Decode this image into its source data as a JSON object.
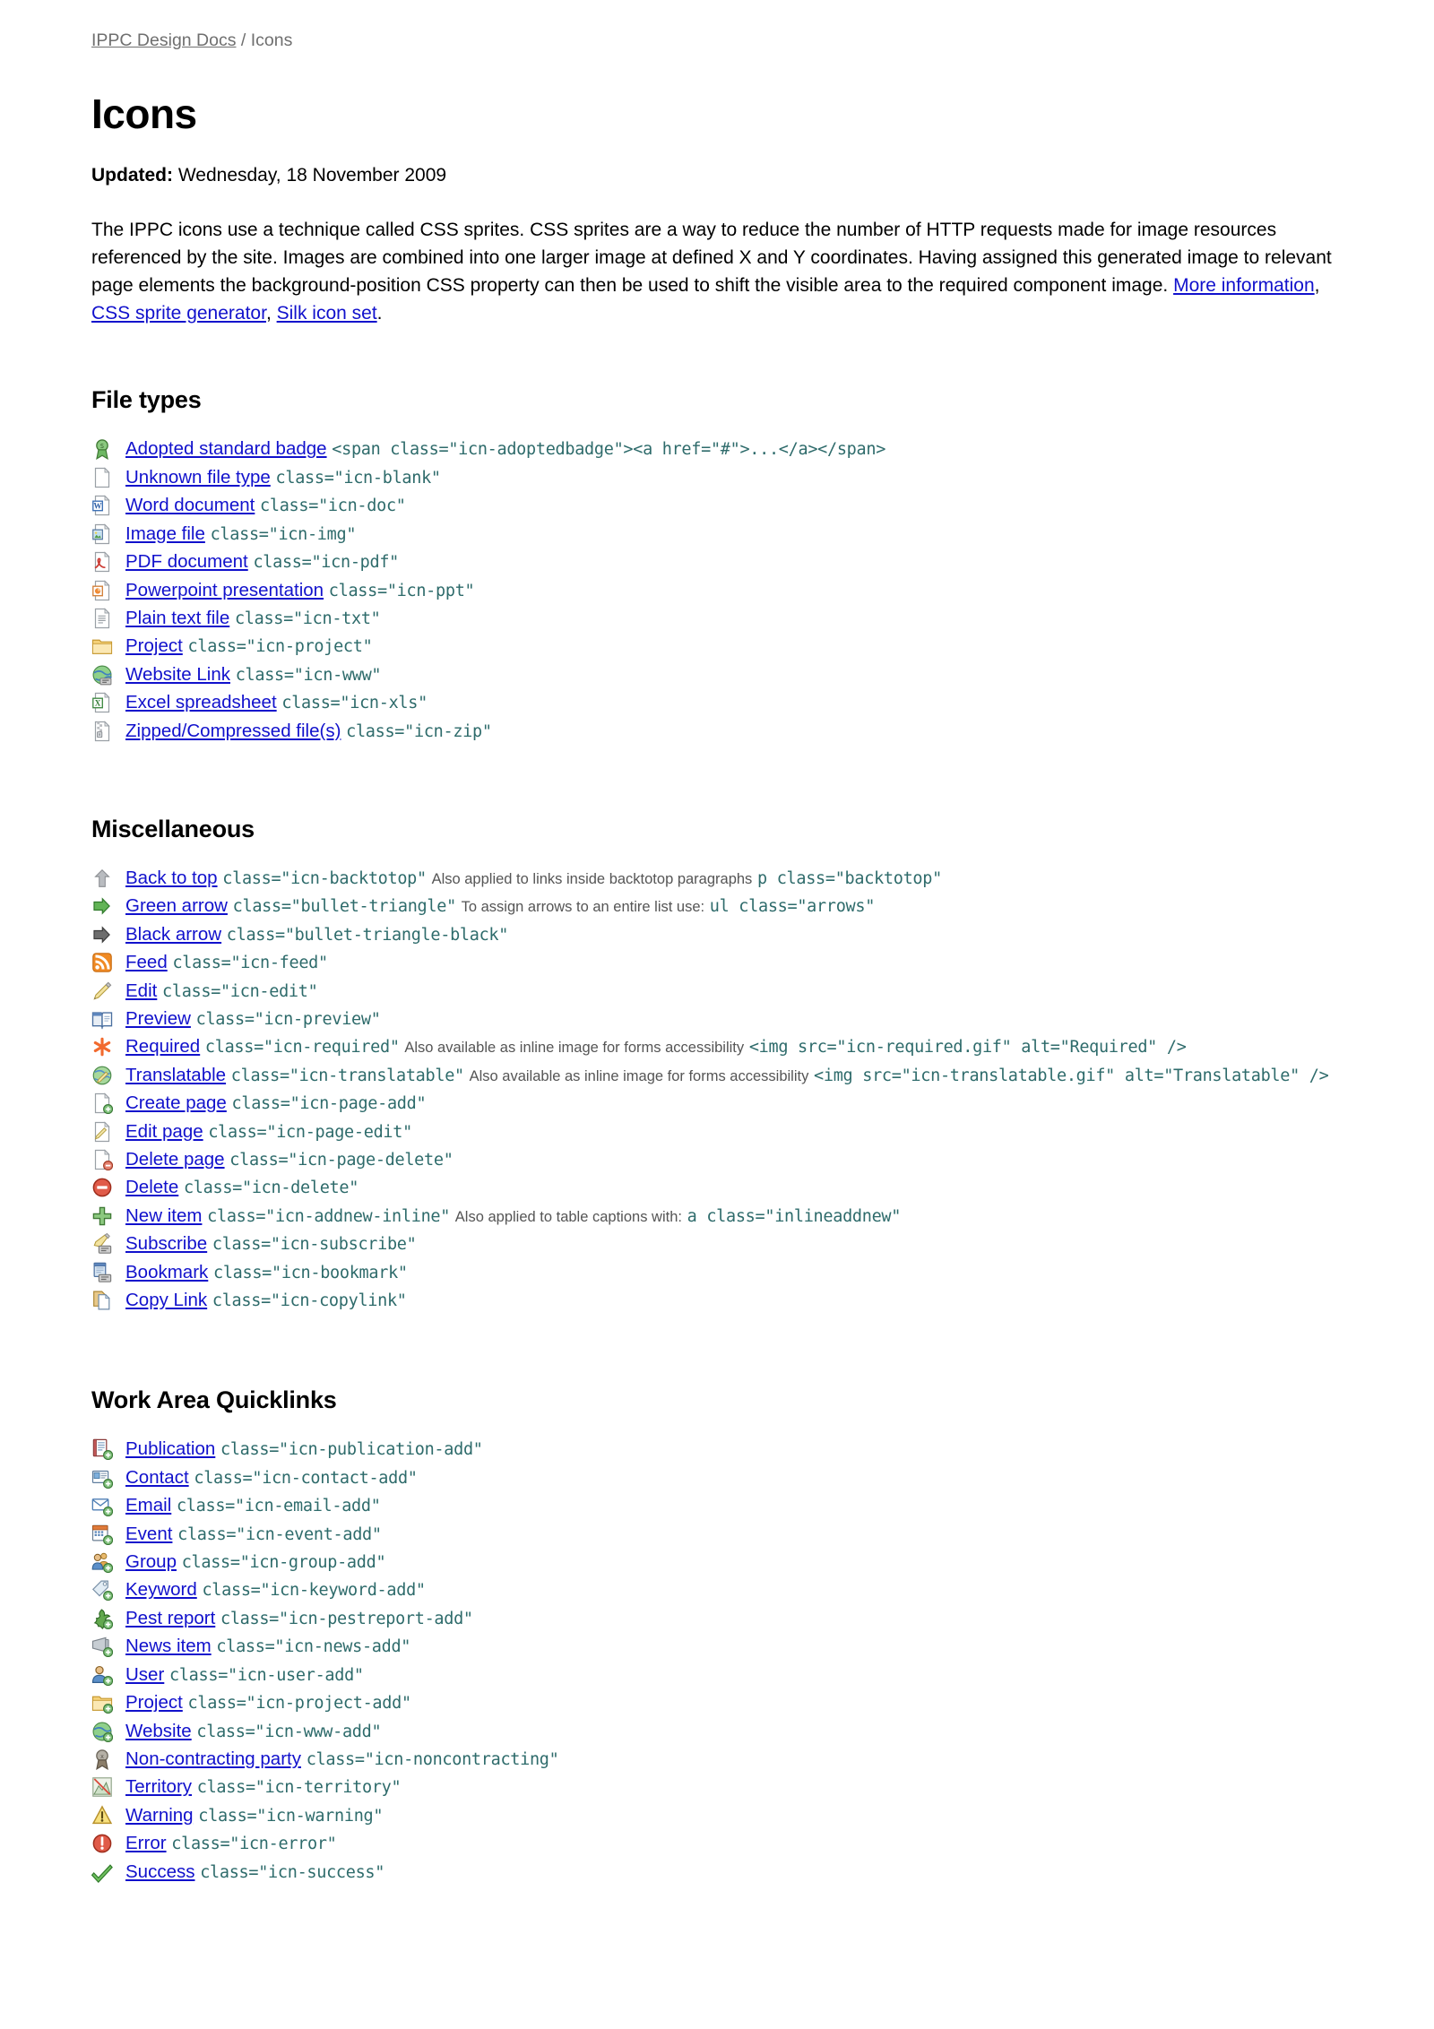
{
  "breadcrumb": {
    "parent": "IPPC Design Docs",
    "separator": "/",
    "current": "Icons"
  },
  "page_title": "Icons",
  "updated": {
    "label": "Updated:",
    "value": "Wednesday, 18 November 2009"
  },
  "intro": {
    "text_1": "The IPPC icons use a technique called CSS sprites. CSS sprites are a way to reduce the number of HTTP requests made for image resources referenced by the site. Images are combined into one larger image at defined X and Y coordinates. Having assigned this generated image to relevant page elements the background-position CSS property can then be used to shift the visible area to the required component image. ",
    "link_1": "More information",
    "sep_1": ", ",
    "link_2": "CSS sprite generator",
    "sep_2": ", ",
    "link_3": "Silk icon set",
    "text_end": "."
  },
  "sections": [
    {
      "id": "file-types",
      "title": "File types",
      "items": [
        {
          "icon": "adopted-badge-icon",
          "label": "Adopted standard badge",
          "code": "<span class=\"icn-adoptedbadge\"><a href=\"#\">...</a></span>",
          "note": "",
          "code2": ""
        },
        {
          "icon": "blank-file-icon",
          "label": "Unknown file type",
          "code": "class=\"icn-blank\"",
          "note": "",
          "code2": ""
        },
        {
          "icon": "word-document-icon",
          "label": "Word document",
          "code": "class=\"icn-doc\"",
          "note": "",
          "code2": ""
        },
        {
          "icon": "image-file-icon",
          "label": "Image file",
          "code": "class=\"icn-img\"",
          "note": "",
          "code2": ""
        },
        {
          "icon": "pdf-document-icon",
          "label": "PDF document",
          "code": "class=\"icn-pdf\"",
          "note": "",
          "code2": ""
        },
        {
          "icon": "powerpoint-icon",
          "label": "Powerpoint presentation",
          "code": "class=\"icn-ppt\"",
          "note": "",
          "code2": ""
        },
        {
          "icon": "plain-text-icon",
          "label": "Plain text file",
          "code": "class=\"icn-txt\"",
          "note": "",
          "code2": ""
        },
        {
          "icon": "project-folder-icon",
          "label": "Project",
          "code": "class=\"icn-project\"",
          "note": "",
          "code2": ""
        },
        {
          "icon": "website-link-icon",
          "label": "Website Link",
          "code": "class=\"icn-www\"",
          "note": "",
          "code2": ""
        },
        {
          "icon": "excel-spreadsheet-icon",
          "label": "Excel spreadsheet",
          "code": "class=\"icn-xls\"",
          "note": "",
          "code2": ""
        },
        {
          "icon": "zip-file-icon",
          "label": "Zipped/Compressed file(s)",
          "code": "class=\"icn-zip\"",
          "note": "",
          "code2": ""
        }
      ]
    },
    {
      "id": "miscellaneous",
      "title": "Miscellaneous",
      "items": [
        {
          "icon": "backtotop-arrow-icon",
          "label": "Back to top",
          "code": "class=\"icn-backtotop\"",
          "note": "Also applied to links inside backtotop paragraphs",
          "code2": "p class=\"backtotop\""
        },
        {
          "icon": "green-arrow-icon",
          "label": "Green arrow",
          "code": "class=\"bullet-triangle\"",
          "note": "To assign arrows to an entire list use:",
          "code2": "ul class=\"arrows\""
        },
        {
          "icon": "black-arrow-icon",
          "label": "Black arrow",
          "code": "class=\"bullet-triangle-black\"",
          "note": "",
          "code2": ""
        },
        {
          "icon": "feed-icon",
          "label": "Feed",
          "code": "class=\"icn-feed\"",
          "note": "",
          "code2": ""
        },
        {
          "icon": "edit-pencil-icon",
          "label": "Edit",
          "code": "class=\"icn-edit\"",
          "note": "",
          "code2": ""
        },
        {
          "icon": "preview-book-icon",
          "label": "Preview",
          "code": "class=\"icn-preview\"",
          "note": "",
          "code2": ""
        },
        {
          "icon": "required-asterisk-icon",
          "label": "Required",
          "code": "class=\"icn-required\"",
          "note": "Also available as inline image for forms accessibility",
          "code2": "<img src=\"icn-required.gif\" alt=\"Required\" />"
        },
        {
          "icon": "translatable-icon",
          "label": "Translatable",
          "code": "class=\"icn-translatable\"",
          "note": "Also available as inline image for forms accessibility",
          "code2": "<img src=\"icn-translatable.gif\" alt=\"Translatable\" />"
        },
        {
          "icon": "page-add-icon",
          "label": "Create page",
          "code": "class=\"icn-page-add\"",
          "note": "",
          "code2": ""
        },
        {
          "icon": "page-edit-icon",
          "label": "Edit page",
          "code": "class=\"icn-page-edit\"",
          "note": "",
          "code2": ""
        },
        {
          "icon": "page-delete-icon",
          "label": "Delete page",
          "code": "class=\"icn-page-delete\"",
          "note": "",
          "code2": ""
        },
        {
          "icon": "delete-icon",
          "label": "Delete",
          "code": "class=\"icn-delete\"",
          "note": "",
          "code2": ""
        },
        {
          "icon": "addnew-inline-icon",
          "label": "New item",
          "code": "class=\"icn-addnew-inline\"",
          "note": "Also applied to table captions with:",
          "code2": "a class=\"inlineaddnew\""
        },
        {
          "icon": "subscribe-icon",
          "label": "Subscribe",
          "code": "class=\"icn-subscribe\"",
          "note": "",
          "code2": ""
        },
        {
          "icon": "bookmark-icon",
          "label": "Bookmark",
          "code": "class=\"icn-bookmark\"",
          "note": "",
          "code2": ""
        },
        {
          "icon": "copylink-icon",
          "label": "Copy Link",
          "code": "class=\"icn-copylink\"",
          "note": "",
          "code2": ""
        }
      ]
    },
    {
      "id": "work-area-quicklinks",
      "title": "Work Area Quicklinks",
      "items": [
        {
          "icon": "publication-add-icon",
          "label": "Publication",
          "code": "class=\"icn-publication-add\"",
          "note": "",
          "code2": ""
        },
        {
          "icon": "contact-add-icon",
          "label": "Contact",
          "code": "class=\"icn-contact-add\"",
          "note": "",
          "code2": ""
        },
        {
          "icon": "email-add-icon",
          "label": "Email",
          "code": "class=\"icn-email-add\"",
          "note": "",
          "code2": ""
        },
        {
          "icon": "event-add-icon",
          "label": "Event",
          "code": "class=\"icn-event-add\"",
          "note": "",
          "code2": ""
        },
        {
          "icon": "group-add-icon",
          "label": "Group",
          "code": "class=\"icn-group-add\"",
          "note": "",
          "code2": ""
        },
        {
          "icon": "keyword-add-icon",
          "label": "Keyword",
          "code": "class=\"icn-keyword-add\"",
          "note": "",
          "code2": ""
        },
        {
          "icon": "pestreport-add-icon",
          "label": "Pest report",
          "code": "class=\"icn-pestreport-add\"",
          "note": "",
          "code2": ""
        },
        {
          "icon": "news-add-icon",
          "label": "News item",
          "code": "class=\"icn-news-add\"",
          "note": "",
          "code2": ""
        },
        {
          "icon": "user-add-icon",
          "label": "User",
          "code": "class=\"icn-user-add\"",
          "note": "",
          "code2": ""
        },
        {
          "icon": "project-add-icon",
          "label": "Project",
          "code": "class=\"icn-project-add\"",
          "note": "",
          "code2": ""
        },
        {
          "icon": "www-add-icon",
          "label": "Website",
          "code": "class=\"icn-www-add\"",
          "note": "",
          "code2": ""
        },
        {
          "icon": "noncontracting-icon",
          "label": "Non-contracting party",
          "code": "class=\"icn-noncontracting\"",
          "note": "",
          "code2": ""
        },
        {
          "icon": "territory-icon",
          "label": "Territory",
          "code": "class=\"icn-territory\"",
          "note": "",
          "code2": ""
        },
        {
          "icon": "warning-icon",
          "label": "Warning",
          "code": "class=\"icn-warning\"",
          "note": "",
          "code2": ""
        },
        {
          "icon": "error-icon",
          "label": "Error",
          "code": "class=\"icn-error\"",
          "note": "",
          "code2": ""
        },
        {
          "icon": "success-icon",
          "label": "Success",
          "code": "class=\"icn-success\"",
          "note": "",
          "code2": ""
        }
      ]
    }
  ],
  "colors": {
    "link": "#1111cc",
    "code": "#2e6b6b",
    "note": "#555555",
    "breadcrumb": "#6f6f6f"
  }
}
